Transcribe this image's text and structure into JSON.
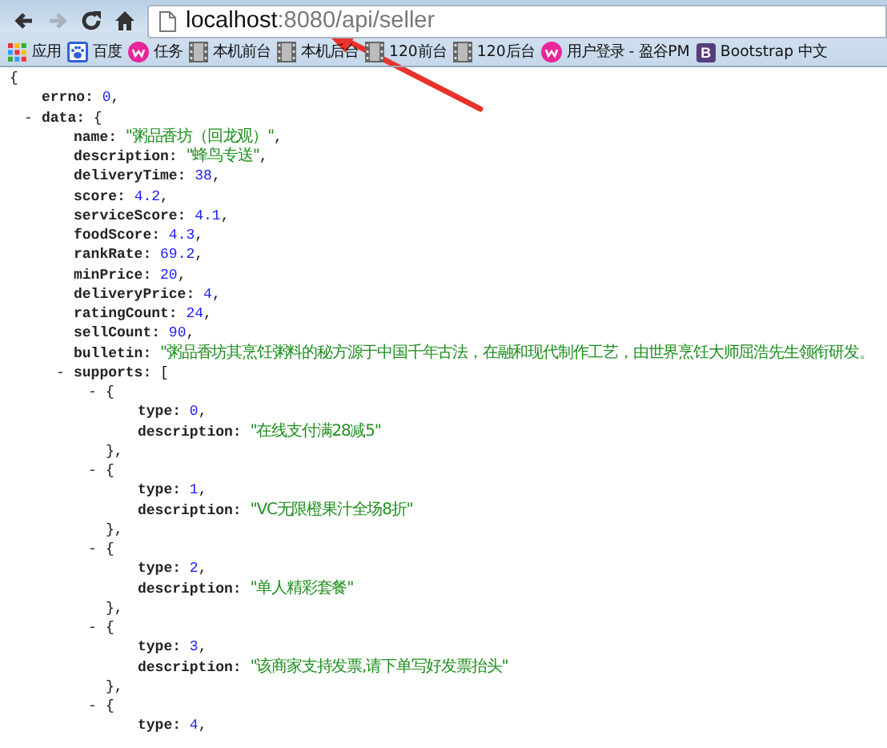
{
  "toolbar": {
    "nav_buttons": [
      {
        "kind": "back",
        "disabled": false
      },
      {
        "kind": "forward",
        "disabled": true
      },
      {
        "kind": "reload",
        "disabled": false
      },
      {
        "kind": "home",
        "disabled": false
      }
    ],
    "address": {
      "host": "localhost",
      "path": ":8080/api/seller"
    }
  },
  "bookmarks": [
    {
      "kind": "apps",
      "label": "应用"
    },
    {
      "kind": "paw",
      "label": "百度"
    },
    {
      "kind": "pink",
      "label": "任务"
    },
    {
      "kind": "film",
      "label": "本机前台"
    },
    {
      "kind": "film",
      "label": "本机后台"
    },
    {
      "kind": "film",
      "label": "120前台"
    },
    {
      "kind": "film",
      "label": "120后台"
    },
    {
      "kind": "pink",
      "label": "用户登录 - 盈谷PM"
    },
    {
      "kind": "letter",
      "icon_text": "B",
      "label": "Bootstrap 中文"
    }
  ],
  "json_view": {
    "kind": "object",
    "open": "{",
    "children": [
      {
        "kind": "number",
        "key": "errno:",
        "value": "0",
        "trailing": ","
      },
      {
        "kind": "object",
        "toggle": "-",
        "key": "data:",
        "open": "{",
        "children": [
          {
            "kind": "string",
            "key": "name:",
            "value": "\"粥品香坊（回龙观）\"",
            "trailing": ","
          },
          {
            "kind": "string",
            "key": "description:",
            "value": "\"蜂鸟专送\"",
            "trailing": ","
          },
          {
            "kind": "number",
            "key": "deliveryTime:",
            "value": "38",
            "trailing": ","
          },
          {
            "kind": "number",
            "key": "score:",
            "value": "4.2",
            "trailing": ","
          },
          {
            "kind": "number",
            "key": "serviceScore:",
            "value": "4.1",
            "trailing": ","
          },
          {
            "kind": "number",
            "key": "foodScore:",
            "value": "4.3",
            "trailing": ","
          },
          {
            "kind": "number",
            "key": "rankRate:",
            "value": "69.2",
            "trailing": ","
          },
          {
            "kind": "number",
            "key": "minPrice:",
            "value": "20",
            "trailing": ","
          },
          {
            "kind": "number",
            "key": "deliveryPrice:",
            "value": "4",
            "trailing": ","
          },
          {
            "kind": "number",
            "key": "ratingCount:",
            "value": "24",
            "trailing": ","
          },
          {
            "kind": "number",
            "key": "sellCount:",
            "value": "90",
            "trailing": ","
          },
          {
            "kind": "string",
            "key": "bulletin:",
            "value": "\"粥品香坊其烹饪粥料的秘方源于中国千年古法，在融和现代制作工艺，由世界烹饪大师屈浩先生领衔研发。"
          },
          {
            "kind": "object",
            "toggle": "-",
            "key": "supports:",
            "open": "[",
            "children": [
              {
                "kind": "object",
                "toggle": "-",
                "open": "{",
                "close": "},",
                "children": [
                  {
                    "kind": "number",
                    "key": "type:",
                    "value": "0",
                    "trailing": ","
                  },
                  {
                    "kind": "string",
                    "key": "description:",
                    "value": "\"在线支付满28减5\""
                  }
                ]
              },
              {
                "kind": "object",
                "toggle": "-",
                "open": "{",
                "close": "},",
                "children": [
                  {
                    "kind": "number",
                    "key": "type:",
                    "value": "1",
                    "trailing": ","
                  },
                  {
                    "kind": "string",
                    "key": "description:",
                    "value": "\"VC无限橙果汁全场8折\""
                  }
                ]
              },
              {
                "kind": "object",
                "toggle": "-",
                "open": "{",
                "close": "},",
                "children": [
                  {
                    "kind": "number",
                    "key": "type:",
                    "value": "2",
                    "trailing": ","
                  },
                  {
                    "kind": "string",
                    "key": "description:",
                    "value": "\"单人精彩套餐\""
                  }
                ]
              },
              {
                "kind": "object",
                "toggle": "-",
                "open": "{",
                "close": "},",
                "children": [
                  {
                    "kind": "number",
                    "key": "type:",
                    "value": "3",
                    "trailing": ","
                  },
                  {
                    "kind": "string",
                    "key": "description:",
                    "value": "\"该商家支持发票,请下单写好发票抬头\""
                  }
                ]
              },
              {
                "kind": "object",
                "toggle": "-",
                "open": "{",
                "children": [
                  {
                    "kind": "number",
                    "key": "type:",
                    "value": "4",
                    "trailing": ","
                  }
                ]
              }
            ]
          }
        ]
      }
    ]
  },
  "annotations": [
    {
      "kind": "arrow"
    }
  ]
}
